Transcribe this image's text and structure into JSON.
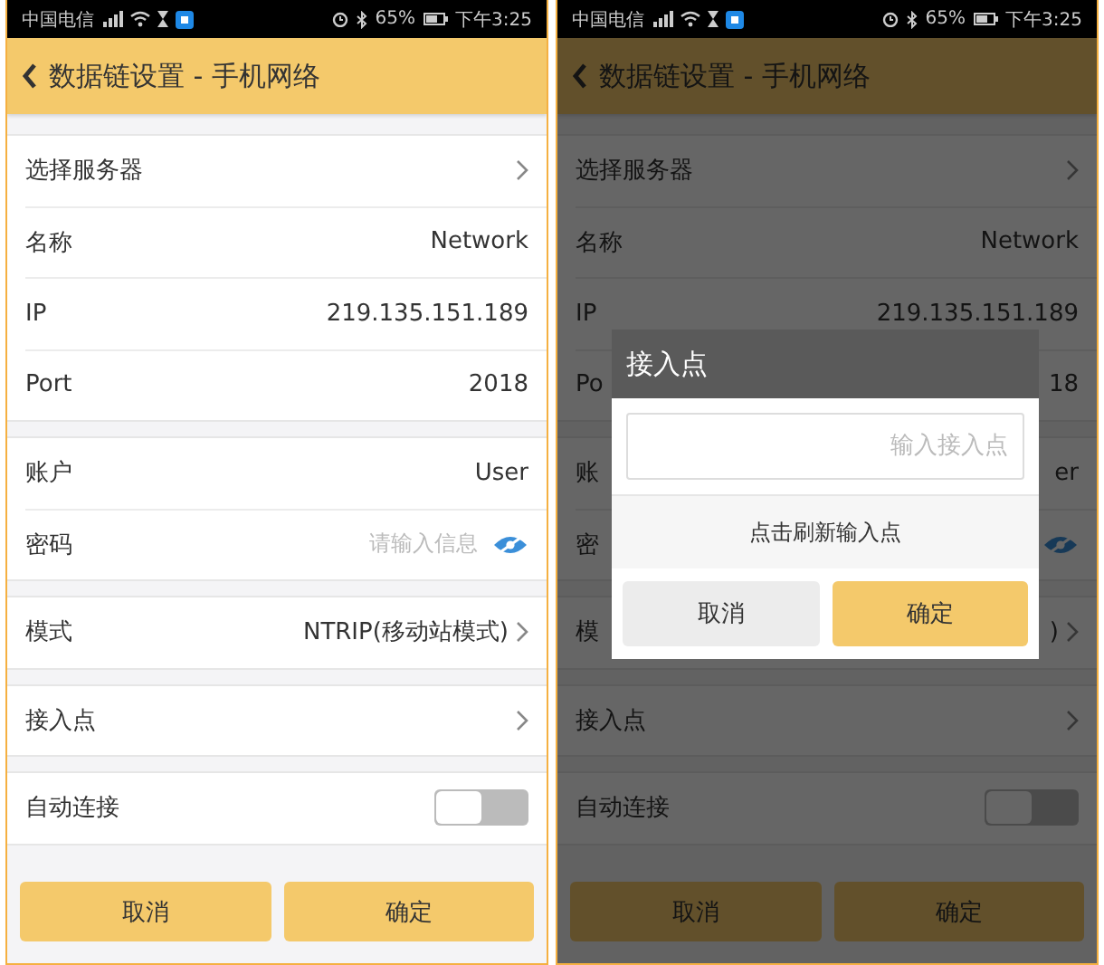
{
  "screens": [
    {
      "status_bar": {
        "carrier": "中国电信",
        "battery": "65%",
        "time": "下午3:25"
      },
      "header": {
        "title": "数据链设置 - 手机网络"
      },
      "groups": [
        [
          {
            "kind": "nav",
            "label": "选择服务器"
          },
          {
            "kind": "value",
            "label": "名称",
            "value": "Network"
          },
          {
            "kind": "value",
            "label": "IP",
            "value": "219.135.151.189"
          },
          {
            "kind": "value",
            "label": "Port",
            "value": "2018"
          }
        ],
        [
          {
            "kind": "value",
            "label": "账户",
            "value": "User"
          },
          {
            "kind": "password",
            "label": "密码",
            "placeholder": "请输入信息"
          }
        ],
        [
          {
            "kind": "nav",
            "label": "模式",
            "value": "NTRIP(移动站模式)"
          }
        ],
        [
          {
            "kind": "nav",
            "label": "接入点"
          }
        ],
        [
          {
            "kind": "toggle",
            "label": "自动连接",
            "on": false
          }
        ]
      ],
      "buttons": [
        "取消",
        "确定"
      ]
    },
    {
      "status_bar": {
        "carrier": "中国电信",
        "battery": "65%",
        "time": "下午3:25"
      },
      "header": {
        "title": "数据链设置 - 手机网络"
      },
      "groups": [
        [
          {
            "kind": "nav",
            "label": "选择服务器"
          },
          {
            "kind": "value",
            "label": "名称",
            "value": "Network"
          },
          {
            "kind": "value",
            "label": "IP",
            "value": "219.135.151.189"
          },
          {
            "kind": "value",
            "label": "Po",
            "value": "18"
          }
        ],
        [
          {
            "kind": "value",
            "label": "账",
            "value": "er"
          },
          {
            "kind": "password",
            "label": "密"
          }
        ],
        [
          {
            "kind": "nav",
            "label": "模",
            "value": ")"
          }
        ],
        [
          {
            "kind": "nav",
            "label": "接入点"
          }
        ],
        [
          {
            "kind": "toggle",
            "label": "自动连接",
            "on": false
          }
        ]
      ],
      "buttons": [
        "取消",
        "确定"
      ],
      "dialog": {
        "title": "接入点",
        "placeholder": "输入接入点",
        "hint": "点击刷新输入点",
        "buttons": [
          {
            "kind": "cancel",
            "label": "取消"
          },
          {
            "kind": "confirm",
            "label": "确定"
          }
        ]
      }
    }
  ]
}
